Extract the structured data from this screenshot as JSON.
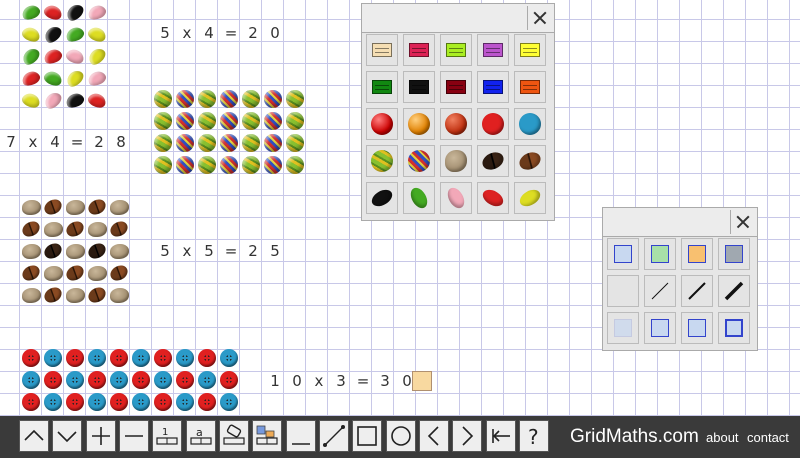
{
  "equations": {
    "eq1": [
      "5",
      "x",
      "4",
      "=",
      "2",
      "0"
    ],
    "eq2": [
      "7",
      "x",
      "4",
      "=",
      "2",
      "8"
    ],
    "eq3": [
      "5",
      "x",
      "5",
      "=",
      "2",
      "5"
    ],
    "eq4": [
      "1",
      "0",
      "x",
      "3",
      "=",
      "3",
      "0"
    ]
  },
  "arrays": {
    "jellybeans": {
      "rows": 5,
      "cols": 4,
      "item": "jellybean",
      "colors": [
        "#44aa22",
        "#dd2222",
        "#111111",
        "#f2a8b8",
        "#dddd22",
        "#111111",
        "#44aa22",
        "#dddd22",
        "#44aa22",
        "#dd2222",
        "#f2a8b8",
        "#dddd22",
        "#dd2222",
        "#44aa22",
        "#dddd22",
        "#f2a8b8",
        "#dddd22",
        "#f2a8b8",
        "#111111",
        "#dd2222"
      ]
    },
    "marbles": {
      "rows": 4,
      "cols": 7,
      "item": "marble"
    },
    "beans": {
      "rows": 5,
      "cols": 5,
      "item": "pebble-coffee"
    },
    "buttons": {
      "rows": 3,
      "cols": 10,
      "item": "button"
    }
  },
  "item_palette": {
    "swatches": [
      "#f5deb3",
      "#dd2255",
      "#aaee22",
      "#bb55cc",
      "#ffff33",
      "#118811",
      "#111111",
      "#880011",
      "#1122ee",
      "#ee5511"
    ],
    "icons": [
      "red-ball-icon",
      "orange-ball-icon",
      "red-marble-icon",
      "red-button-icon",
      "blue-button-icon",
      "green-marble-icon",
      "striped-marble-icon",
      "pebble-icon",
      "dark-coffee-bean-icon",
      "coffee-bean-icon",
      "black-jellybean-icon",
      "green-jellybean-icon",
      "pink-jellybean-icon",
      "red-jellybean-icon",
      "yellow-jellybean-icon"
    ]
  },
  "shape_palette": {
    "fill_colors": [
      "#c8d8f0",
      "#a8e0a8",
      "#f8c070",
      "#a0a8b0"
    ],
    "border_color": "#3344cc",
    "line_weights": [
      "none",
      "thin",
      "medium",
      "thick"
    ]
  },
  "toolbar": {
    "brand": "GridMaths.com",
    "about": "about",
    "contact": "contact"
  }
}
